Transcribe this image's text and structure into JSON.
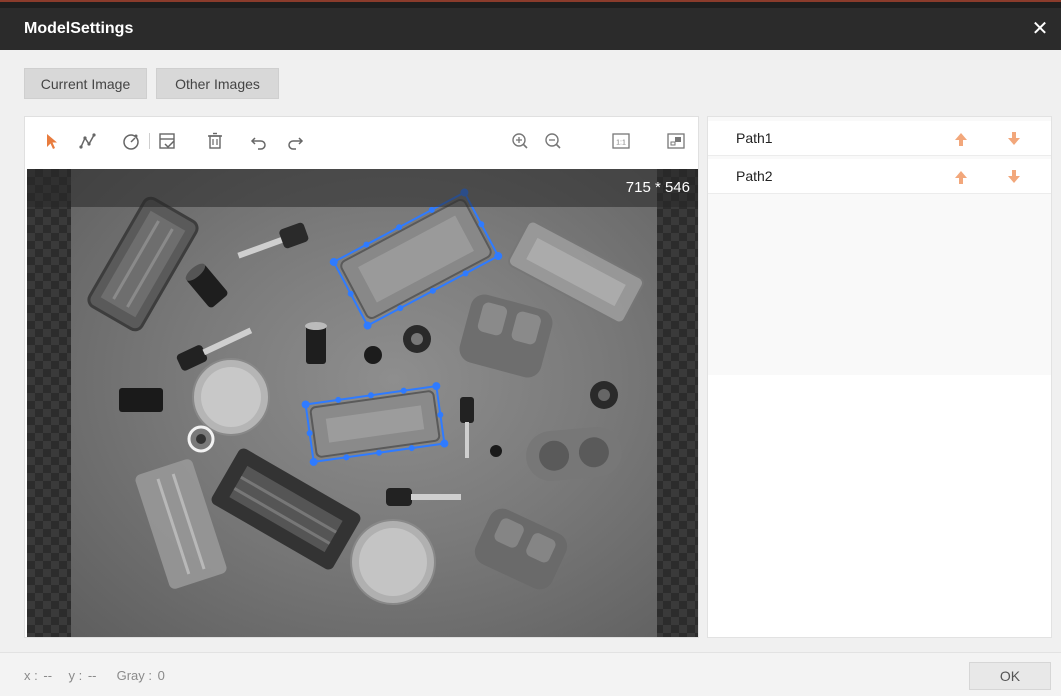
{
  "window": {
    "title": "ModelSettings",
    "close_icon": "close-icon"
  },
  "tabs": [
    {
      "label": "Current Image"
    },
    {
      "label": "Other Images"
    }
  ],
  "toolbar": {
    "tools": [
      "select-arrow-icon",
      "polyline-icon",
      "circle-tool-icon",
      "checklist-icon",
      "delete-icon",
      "undo-icon",
      "redo-icon",
      "zoom-in-icon",
      "zoom-out-icon",
      "actual-size-icon",
      "fit-window-icon"
    ],
    "actual_size_label": "1:1"
  },
  "viewer": {
    "image_size": "715 * 546"
  },
  "paths": [
    {
      "name": "Path1"
    },
    {
      "name": "Path2"
    }
  ],
  "status": {
    "x_label": "x :",
    "x_value": "--",
    "y_label": "y :",
    "y_value": "--",
    "gray_label": "Gray :",
    "gray_value": "0"
  },
  "footer": {
    "ok_label": "OK"
  },
  "colors": {
    "accent_select": "#e87c3e",
    "arrow": "#f2a77b",
    "roi": "#2f7bff",
    "title_bar": "#2b2b2b"
  }
}
